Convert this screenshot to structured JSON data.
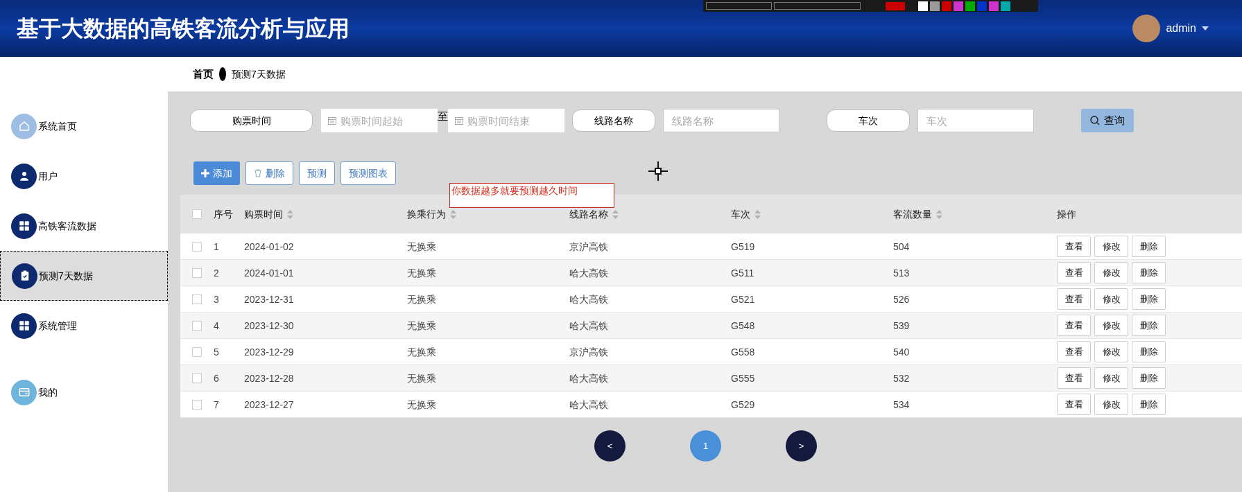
{
  "header": {
    "title": "基于大数据的高铁客流分析与应用",
    "user": "admin"
  },
  "capture_toolbar": {
    "swatches": [
      {
        "color": "#cc0000"
      },
      {
        "color": "#ffffff"
      },
      {
        "color": "#9a9a9a"
      },
      {
        "color": "#cc0000"
      },
      {
        "color": "#cc33cc"
      },
      {
        "color": "#00aa00"
      },
      {
        "color": "#0033cc"
      },
      {
        "color": "#cc33cc"
      },
      {
        "color": "#00aaaa"
      }
    ]
  },
  "breadcrumb": {
    "home": "首页",
    "current": "预测7天数据"
  },
  "sidebar": {
    "items": [
      {
        "label": "系统首页",
        "color": "#9dbde3",
        "selected": false
      },
      {
        "label": "用户",
        "color": "#0d2a6f",
        "selected": false
      },
      {
        "label": "高铁客流数据",
        "color": "#0d2a6f",
        "selected": false
      },
      {
        "label": "预测7天数据",
        "color": "#0d2a6f",
        "selected": true
      },
      {
        "label": "系统管理",
        "color": "#0d2a6f",
        "selected": false
      },
      {
        "label": "我的",
        "color": "#6fb4dd",
        "selected": false
      }
    ]
  },
  "filters": {
    "time_label": "购票时间",
    "start_placeholder": "购票时间起始",
    "range_separator": "至",
    "end_placeholder": "购票时间结束",
    "line_label": "线路名称",
    "line_placeholder": "线路名称",
    "train_label": "车次",
    "train_placeholder": "车次",
    "search_button": "查询"
  },
  "actions": [
    {
      "label": "添加",
      "kind": "primary"
    },
    {
      "label": "删除",
      "kind": "outline"
    },
    {
      "label": "预测",
      "kind": "outline"
    },
    {
      "label": "预测图表",
      "kind": "outline"
    }
  ],
  "note": "你数据越多就要预测越久时间",
  "table": {
    "select_all_checked": false,
    "columns": [
      {
        "label": "序号",
        "sortable": false
      },
      {
        "label": "购票时间",
        "sortable": true
      },
      {
        "label": "换乘行为",
        "sortable": true
      },
      {
        "label": "线路名称",
        "sortable": true
      },
      {
        "label": "车次",
        "sortable": true
      },
      {
        "label": "客流数量",
        "sortable": true
      },
      {
        "label": "操作",
        "sortable": false
      }
    ],
    "rows": [
      {
        "checked": false,
        "cells": [
          "1",
          "2024-01-02",
          "无换乘",
          "京沪高铁",
          "G519",
          "504"
        ],
        "buttons": [
          "查看",
          "修改",
          "删除"
        ]
      },
      {
        "checked": false,
        "cells": [
          "2",
          "2024-01-01",
          "无换乘",
          "哈大高铁",
          "G511",
          "513"
        ],
        "buttons": [
          "查看",
          "修改",
          "删除"
        ]
      },
      {
        "checked": false,
        "cells": [
          "3",
          "2023-12-31",
          "无换乘",
          "哈大高铁",
          "G521",
          "526"
        ],
        "buttons": [
          "查看",
          "修改",
          "删除"
        ]
      },
      {
        "checked": false,
        "cells": [
          "4",
          "2023-12-30",
          "无换乘",
          "哈大高铁",
          "G548",
          "539"
        ],
        "buttons": [
          "查看",
          "修改",
          "删除"
        ]
      },
      {
        "checked": false,
        "cells": [
          "5",
          "2023-12-29",
          "无换乘",
          "京沪高铁",
          "G558",
          "540"
        ],
        "buttons": [
          "查看",
          "修改",
          "删除"
        ]
      },
      {
        "checked": false,
        "cells": [
          "6",
          "2023-12-28",
          "无换乘",
          "哈大高铁",
          "G555",
          "532"
        ],
        "buttons": [
          "查看",
          "修改",
          "删除"
        ]
      },
      {
        "checked": false,
        "cells": [
          "7",
          "2023-12-27",
          "无换乘",
          "哈大高铁",
          "G529",
          "534"
        ],
        "buttons": [
          "查看",
          "修改",
          "删除"
        ]
      }
    ]
  },
  "pagination": [
    {
      "label": "<",
      "selected": false
    },
    {
      "label": "1",
      "selected": true
    },
    {
      "label": ">",
      "selected": false
    }
  ]
}
